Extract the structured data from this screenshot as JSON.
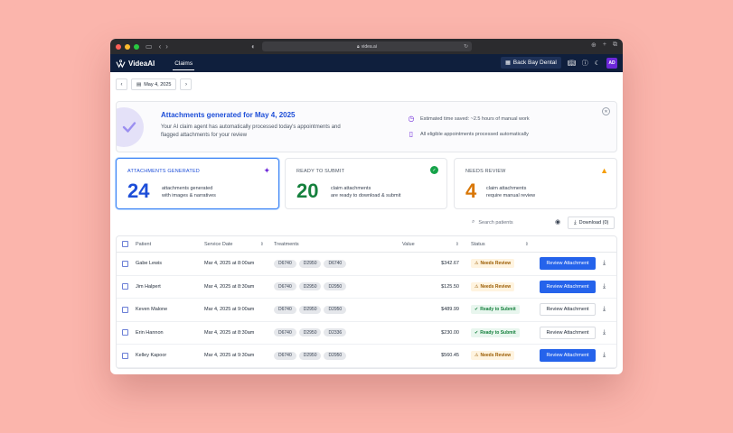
{
  "browser": {
    "url": "videa.ai"
  },
  "app": {
    "logo_text": "VideaAI",
    "nav_tab": "Claims",
    "clinic": "Back Bay Dental",
    "avatar_initials": "AD"
  },
  "date_picker": {
    "value": "May 4, 2025"
  },
  "banner": {
    "title": "Attachments generated for May 4, 2025",
    "description": "Your AI claim agent has automatically processed today's appointments and flagged attachments for your review",
    "info_time": "Estimated time saved: ~2.5 hours of manual work",
    "info_processed": "All eligible appointments processed automatically"
  },
  "cards": [
    {
      "label": "ATTACHMENTS GENERATED",
      "number": "24",
      "line1": "attachments generated",
      "line2": "with images & narratives",
      "color": "#1d4ed8"
    },
    {
      "label": "READY TO SUBMIT",
      "number": "20",
      "line1": "claim attachments",
      "line2": "are ready to download & submit",
      "color": "#15803d"
    },
    {
      "label": "NEEDS REVIEW",
      "number": "4",
      "line1": "claim attachments",
      "line2": "require manual review",
      "color": "#d97706"
    }
  ],
  "toolbar": {
    "search_placeholder": "Search patients",
    "download_label": "Download (0)"
  },
  "table": {
    "headers": {
      "patient": "Patient",
      "service_date": "Service Date",
      "treatments": "Treatments",
      "value": "Value",
      "status": "Status"
    },
    "rows": [
      {
        "patient": "Gabe Lewis",
        "date": "Mar 4, 2025 at 8:00am",
        "t1": "D6740",
        "t2": "D2950",
        "t3": "D6740",
        "value": "$342.67",
        "status": "Needs Review",
        "action": "Review Attachment"
      },
      {
        "patient": "Jim Halpert",
        "date": "Mar 4, 2025 at 8:30am",
        "t1": "D6740",
        "t2": "D2950",
        "t3": "D2950",
        "value": "$125.50",
        "status": "Needs Review",
        "action": "Review Attachment"
      },
      {
        "patient": "Keven Malone",
        "date": "Mar 4, 2025 at 9:00am",
        "t1": "D6740",
        "t2": "D2950",
        "t3": "D2950",
        "value": "$489.99",
        "status": "Ready to Submit",
        "action": "Review Attachment"
      },
      {
        "patient": "Erin Hannon",
        "date": "Mar 4, 2025 at 8:30am",
        "t1": "D6740",
        "t2": "D2950",
        "t3": "D2336",
        "value": "$230.00",
        "status": "Ready to Submit",
        "action": "Review Attachment"
      },
      {
        "patient": "Kelley Kapoor",
        "date": "Mar 4, 2025 at 9:30am",
        "t1": "D6740",
        "t2": "D2950",
        "t3": "D2950",
        "value": "$560.45",
        "status": "Needs Review",
        "action": "Review Attachment"
      }
    ]
  }
}
